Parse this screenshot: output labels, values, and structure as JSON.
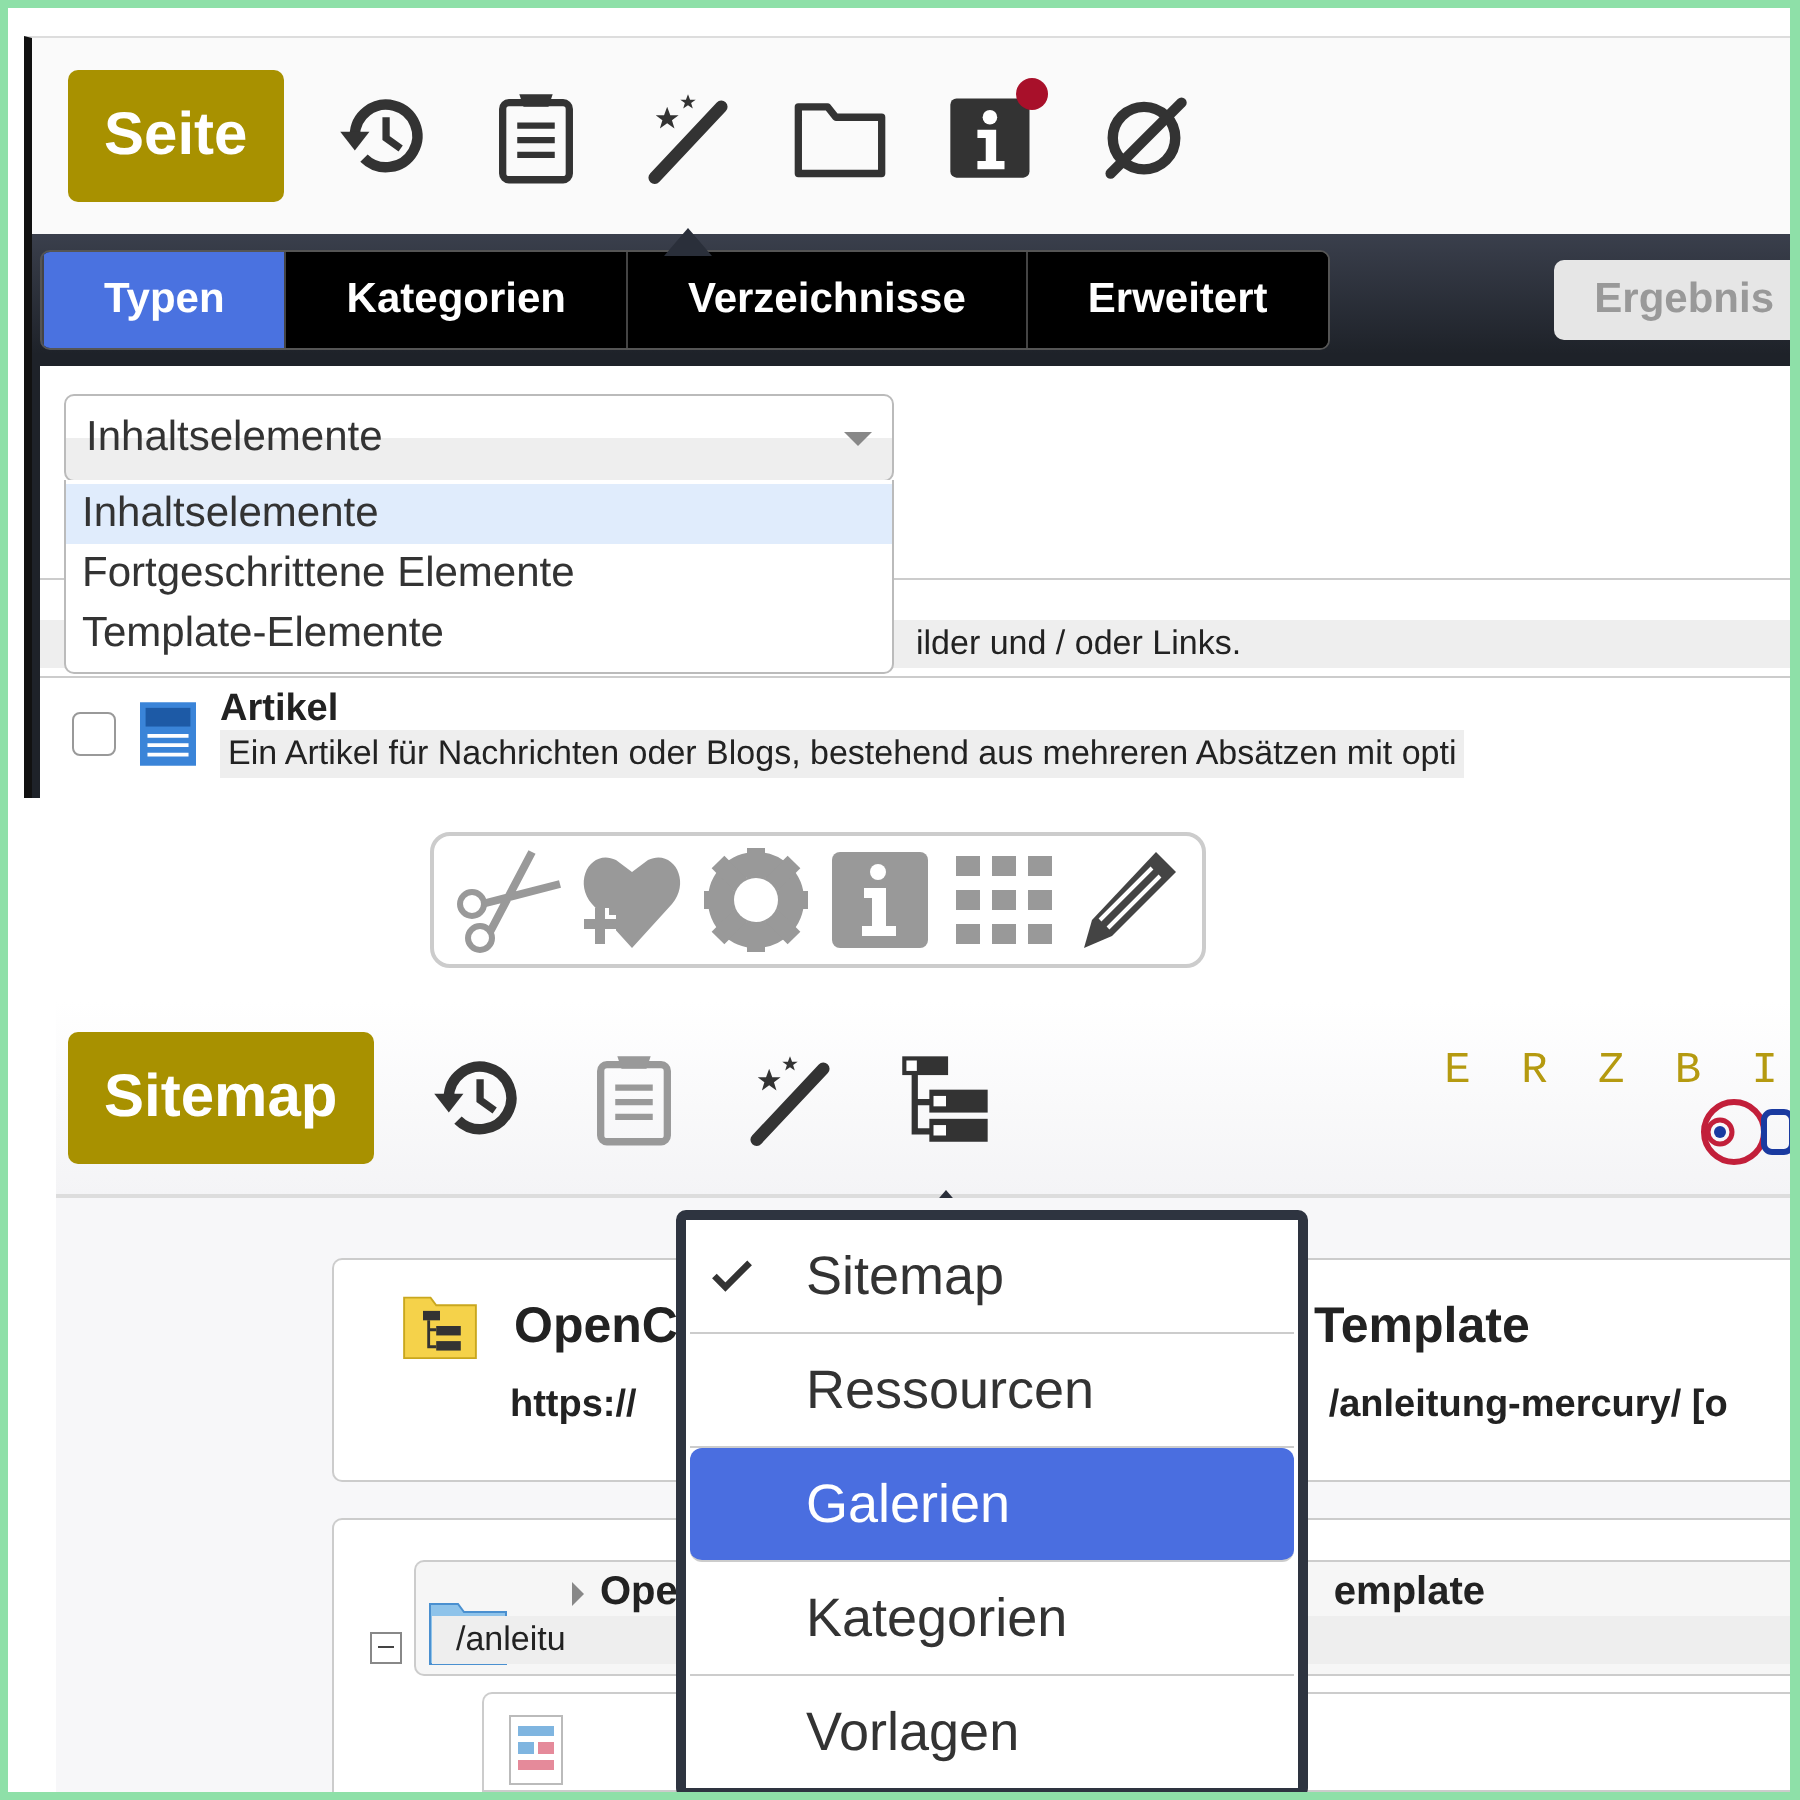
{
  "page_panel": {
    "button": "Seite",
    "toolbar": [
      {
        "kind": "history",
        "disabled": false,
        "selected": false
      },
      {
        "kind": "clipboard",
        "disabled": false,
        "selected": false
      },
      {
        "kind": "wand",
        "disabled": false,
        "selected": true
      },
      {
        "kind": "folder",
        "disabled": false,
        "selected": false
      },
      {
        "kind": "info",
        "disabled": false,
        "selected": false,
        "badge": true
      },
      {
        "kind": "hidden",
        "disabled": false,
        "selected": false
      }
    ],
    "tabs": [
      {
        "label": "Typen",
        "selected": true
      },
      {
        "label": "Kategorien",
        "selected": false
      },
      {
        "label": "Verzeichnisse",
        "selected": false
      },
      {
        "label": "Erweitert",
        "selected": false
      }
    ],
    "results_button": "Ergebnis",
    "select": {
      "value": "Inhaltselemente",
      "options": [
        {
          "label": "Inhaltselemente",
          "selected": true
        },
        {
          "label": "Fortgeschrittene Elemente",
          "selected": false
        },
        {
          "label": "Template-Elemente",
          "selected": false
        }
      ]
    },
    "rows": [
      {
        "kind": "partial",
        "description": "ilder und / oder Links."
      },
      {
        "kind": "full",
        "checked": false,
        "title": "Artikel",
        "description": "Ein Artikel für Nachrichten oder Blogs, bestehend aus mehreren Absätzen mit opti"
      }
    ]
  },
  "icon_strip": [
    {
      "kind": "scissors"
    },
    {
      "kind": "heart-plus"
    },
    {
      "kind": "gear"
    },
    {
      "kind": "info"
    },
    {
      "kind": "grid"
    },
    {
      "kind": "pencil"
    }
  ],
  "sitemap_panel": {
    "button": "Sitemap",
    "toolbar": [
      {
        "kind": "history",
        "disabled": false,
        "selected": false
      },
      {
        "kind": "clipboard",
        "disabled": true,
        "selected": false
      },
      {
        "kind": "wand",
        "disabled": false,
        "selected": false
      },
      {
        "kind": "sitemap",
        "disabled": false,
        "selected": true
      }
    ],
    "logo_text": "E R Z B I",
    "site_card": {
      "title_parts": [
        "OpenC",
        "Template"
      ],
      "url_parts": [
        "https://",
        "/anleitung-mercury/ [o"
      ]
    },
    "tree": {
      "expanded": true,
      "title_parts": [
        "Ope",
        "emplate"
      ],
      "path": "/anleitu"
    },
    "menu": [
      {
        "label": "Sitemap",
        "checked": true,
        "selected": false
      },
      {
        "label": "Ressourcen",
        "checked": false,
        "selected": false
      },
      {
        "label": "Galerien",
        "checked": false,
        "selected": true
      },
      {
        "label": "Kategorien",
        "checked": false,
        "selected": false
      },
      {
        "label": "Vorlagen",
        "checked": false,
        "selected": false
      }
    ]
  }
}
